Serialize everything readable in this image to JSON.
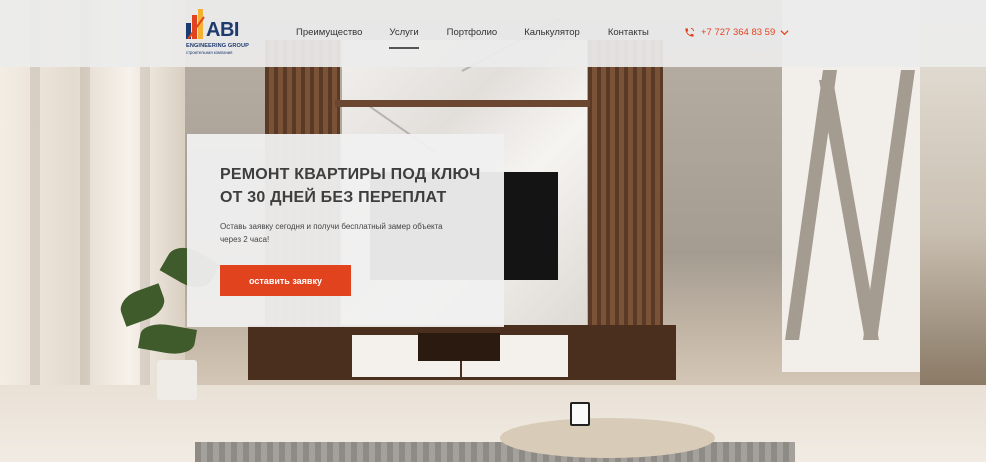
{
  "brand": {
    "name": "ABI",
    "subtitle": "ENGINEERING GROUP",
    "tagline": "строительная компания",
    "colors": [
      "#1d3b6e",
      "#e2431f",
      "#f2b233"
    ]
  },
  "nav": {
    "items": [
      {
        "label": "Преимущество",
        "active": false
      },
      {
        "label": "Услуги",
        "active": true
      },
      {
        "label": "Портфолио",
        "active": false
      },
      {
        "label": "Калькулятор",
        "active": false
      },
      {
        "label": "Контакты",
        "active": false
      }
    ]
  },
  "contact": {
    "phone": "+7 727 364 83 59",
    "icon": "phone-icon",
    "dropdown_icon": "chevron-down-icon"
  },
  "hero": {
    "title_line1": "РЕМОНТ КВАРТИРЫ ПОД КЛЮЧ",
    "title_line2": "ОТ 30 ДНЕЙ БЕЗ ПЕРЕПЛАТ",
    "subtitle": "Оставь заявку сегодня и получи бесплатный замер объекта через 2 часа!",
    "cta_label": "оставить заявку"
  },
  "theme": {
    "accent": "#e2431f",
    "header_bg": "#ececec",
    "text_dark": "#3e3e3e"
  }
}
